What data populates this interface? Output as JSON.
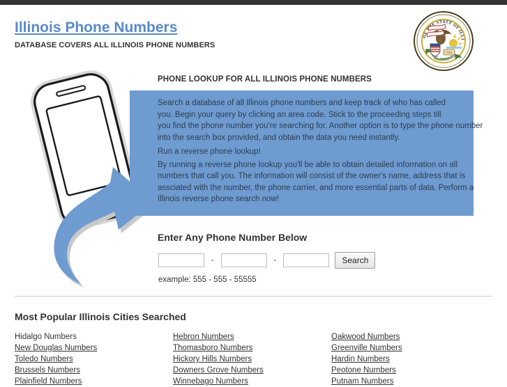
{
  "header": {
    "site_title": "Illinois Phone Numbers",
    "tagline": "DATABASE COVERS ALL ILLINOIS PHONE NUMBERS",
    "seal_icon": "illinois-state-seal-icon",
    "seal_top_text": "SEAL OF THE STATE OF ILLINOIS",
    "seal_bottom_text": "AUG. 26TH 1818"
  },
  "illustration": {
    "phone_icon": "smartphone-icon",
    "arrow_icon": "curved-arrow-icon"
  },
  "info": {
    "heading": "PHONE LOOKUP FOR ALL ILLINOIS PHONE NUMBERS",
    "paragraph1_line1": "Search a database of all Illinois phone numbers and keep track of who has called",
    "paragraph1_line2": "you. Begin your query by clicking an area code. Stick to the proceeding steps till",
    "paragraph1_line3": "you find the phone number you're searching for. Another option is to type the phone number",
    "paragraph1_line4": "into the search box provided, and obtain the data you need instantly.",
    "subheading": "Run a reverse phone lookup!",
    "paragraph2_line1": "By running a reverse phone lookup you'll be able to obtain detailed information on all",
    "paragraph2_line2": "numbers that call you. The information will consist of the owner's name, address that is",
    "paragraph2_line3": "assciated with the number, the phone carrier, and more essential parts of data. Perform a",
    "paragraph2_line4": "Illinois reverse phone search now!"
  },
  "form": {
    "heading": "Enter Any Phone Number Below",
    "area_code_value": "",
    "prefix_value": "",
    "line_value": "",
    "separator": "-",
    "search_label": "Search",
    "example": "example: 555 - 555 - 55555"
  },
  "cities": {
    "heading": "Most Popular Illinois Cities Searched",
    "column1": [
      "Hidalgo Numbers",
      "New Douglas Numbers",
      "Toledo Numbers",
      "Brussels Numbers",
      "Plainfield Numbers"
    ],
    "column2": [
      "Hebron Numbers",
      "Thomasboro Numbers",
      "Hickory Hills Numbers",
      "Downers Grove Numbers",
      "Winnebago Numbers"
    ],
    "column3": [
      "Oakwood Numbers",
      "Greenville Numbers",
      "Hardin Numbers",
      "Peotone Numbers",
      "Putnam Numbers"
    ]
  },
  "colors": {
    "topbar": "#333333",
    "accent_blue": "#6e9bd0",
    "link_blue": "#5a8ac8",
    "divider": "#cccccc"
  }
}
